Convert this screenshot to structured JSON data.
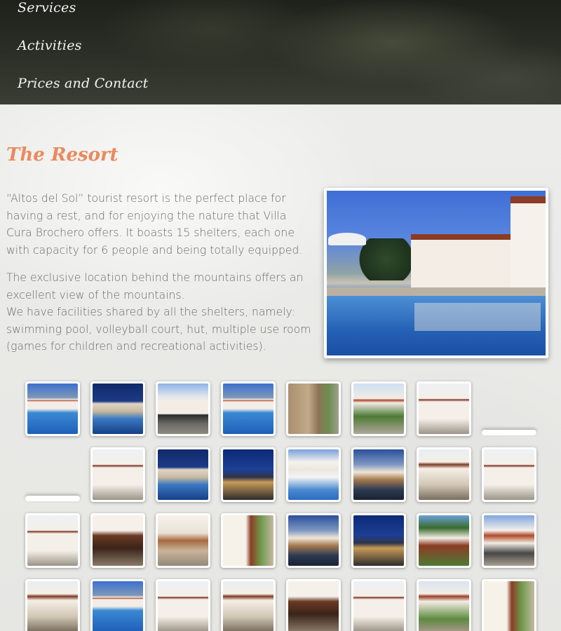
{
  "nav": {
    "items": [
      {
        "label": "Services"
      },
      {
        "label": "Activities"
      },
      {
        "label": "Prices and Contact"
      }
    ]
  },
  "resort": {
    "title": "The Resort",
    "paragraph1": "“Altos del Sol” tourist resort is the perfect place for having a rest, and for enjoying the nature that Villa Cura Brochero offers. It boasts 15 shelters, each one with capacity for 6 people and being totally equipped.",
    "paragraph2_line1": "The exclusive location behind the mountains offers an excellent view of the mountains.",
    "paragraph2_line2": "We have facilities shared by all the shelters, namely: swimming pool, volleyball court, hut, multiple use room (games for children and recreational activities)."
  },
  "gallery": {
    "thumbnails": [
      "p-pool",
      "p-night",
      "p-gate",
      "p-pool",
      "p-stone",
      "p-path",
      "p-white",
      "p-white",
      "p-night",
      "p-dusk",
      "p-umb",
      "p-eve",
      "p-porch",
      "p-white",
      "p-white",
      "p-room",
      "p-stair",
      "p-side",
      "p-eve",
      "p-dusk",
      "p-vine",
      "p-balc",
      "p-porch",
      "p-pool",
      "p-white",
      "p-porch",
      "p-room",
      "p-white",
      "p-roof",
      "p-side"
    ]
  }
}
